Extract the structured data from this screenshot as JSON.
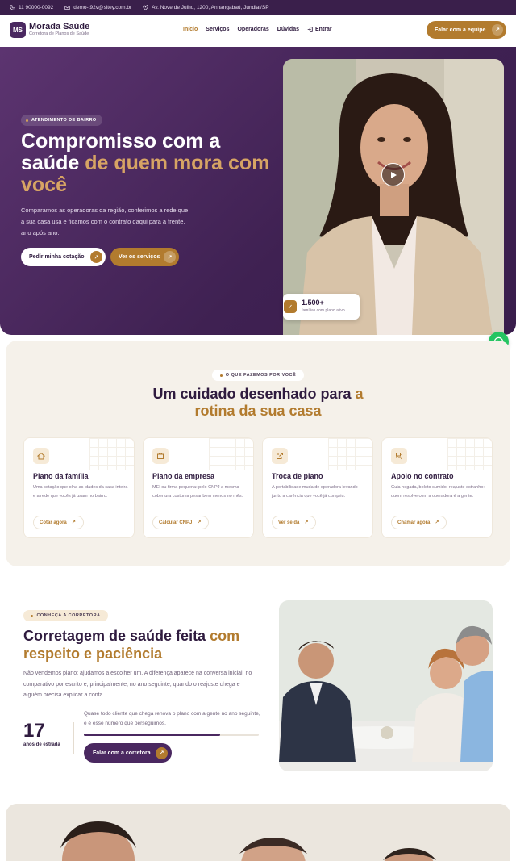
{
  "topbar": {
    "phone": "11 90000-0092",
    "email": "demo-t92v@sitey.com.br",
    "address": "Av. Nove de Julho, 1200, Anhangabaú, Jundiaí/SP"
  },
  "header": {
    "logo_initials": "MS",
    "brand_name": "Morada Saúde",
    "brand_tagline": "Corretora de Planos de Saúde",
    "nav": [
      {
        "label": "Início",
        "active": true
      },
      {
        "label": "Serviços",
        "active": false
      },
      {
        "label": "Operadoras",
        "active": false
      },
      {
        "label": "Dúvidas",
        "active": false
      }
    ],
    "login_label": "Entrar",
    "cta_label": "Falar com a equipe"
  },
  "hero": {
    "badge": "ATENDIMENTO DE BAIRRO",
    "title_part1": "Compromisso com a saúde ",
    "title_highlight": "de quem mora com você",
    "description": "Comparamos as operadoras da região, conferimos a rede que a sua casa usa e ficamos com o contrato daqui para a frente, ano após ano.",
    "primary_cta": "Pedir minha cotação",
    "secondary_cta": "Ver os serviços",
    "stat_number": "1.500+",
    "stat_label": "famílias com plano ativo"
  },
  "services": {
    "badge": "O QUE FAZEMOS POR VOCÊ",
    "title_part1": "Um cuidado desenhado para ",
    "title_highlight": "a rotina da sua casa",
    "cards": [
      {
        "icon": "home-icon",
        "title": "Plano da família",
        "description": "Uma cotação que olha as idades da casa inteira e a rede que vocês já usam no bairro.",
        "link": "Cotar agora"
      },
      {
        "icon": "briefcase-icon",
        "title": "Plano da empresa",
        "description": "MEI ou firma pequena: pelo CNPJ a mesma cobertura costuma pesar bem menos no mês.",
        "link": "Calcular CNPJ"
      },
      {
        "icon": "external-link-icon",
        "title": "Troca de plano",
        "description": "A portabilidade muda de operadora levando junto a carência que você já cumpriu.",
        "link": "Ver se dá"
      },
      {
        "icon": "chat-icon",
        "title": "Apoio no contrato",
        "description": "Guia negada, boleto sumido, reajuste estranho: quem resolve com a operadora é a gente.",
        "link": "Chamar agora"
      }
    ]
  },
  "about": {
    "badge": "CONHEÇA A CORRETORA",
    "title_part1": "Corretagem de saúde feita ",
    "title_highlight": "com respeito e paciência",
    "description": "Não vendemos plano: ajudamos a escolher um. A diferença aparece na conversa inicial, no comparativo por escrito e, principalmente, no ano seguinte, quando o reajuste chega e alguém precisa explicar a conta.",
    "stat_number": "17",
    "stat_label": "anos de estrada",
    "quote": "Quase todo cliente que chega renova o plano com a gente no ano seguinte, e é esse número que perseguimos.",
    "progress_fraction": 0.78,
    "cta": "Falar com a corretora"
  },
  "colors": {
    "primary": "#4a2860",
    "accent": "#b27b2e",
    "whatsapp": "#25c461"
  }
}
